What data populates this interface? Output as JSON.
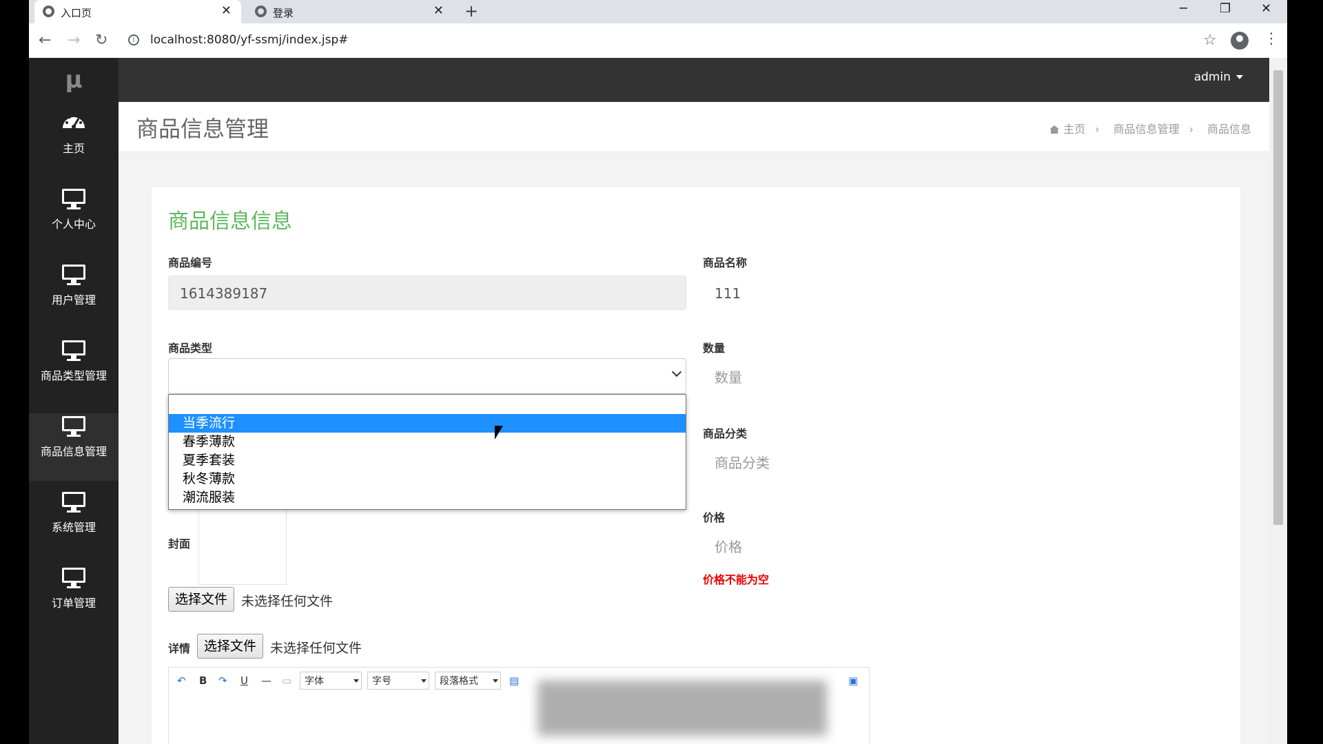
{
  "browser": {
    "tabs": [
      {
        "title": "入口页",
        "close": "✕"
      },
      {
        "title": "登录",
        "close": "✕"
      }
    ],
    "new_tab": "+",
    "window_controls": [
      "─",
      "❐",
      "✕"
    ],
    "url": "localhost:8080/yf-ssmj/index.jsp#"
  },
  "app": {
    "logo": "μ",
    "user_menu": "admin",
    "sidebar": [
      {
        "label": "主页",
        "icon": "dashboard-icon"
      },
      {
        "label": "个人中心",
        "icon": "monitor-icon"
      },
      {
        "label": "用户管理",
        "icon": "monitor-icon"
      },
      {
        "label": "商品类型管理",
        "icon": "monitor-icon"
      },
      {
        "label": "商品信息管理",
        "icon": "monitor-icon"
      },
      {
        "label": "系统管理",
        "icon": "monitor-icon"
      },
      {
        "label": "订单管理",
        "icon": "monitor-icon"
      }
    ],
    "page_title": "商品信息管理",
    "breadcrumb": [
      "主页",
      "商品信息管理",
      "商品信息"
    ]
  },
  "form": {
    "title": "商品信息信息",
    "product_no": {
      "label": "商品编号",
      "value": "1614389187"
    },
    "product_name": {
      "label": "商品名称",
      "value": "111"
    },
    "product_type": {
      "label": "商品类型",
      "value": "",
      "options": [
        "",
        "当季流行",
        "春季薄款",
        "夏季套装",
        "秋冬薄款",
        "潮流服装"
      ],
      "highlighted": "当季流行"
    },
    "quantity": {
      "label": "数量",
      "placeholder": "数量"
    },
    "category": {
      "label": "商品分类",
      "placeholder": "商品分类"
    },
    "price": {
      "label": "价格",
      "placeholder": "价格",
      "error": "价格不能为空"
    },
    "cover": {
      "label": "封面",
      "button": "选择文件",
      "status": "未选择任何文件"
    },
    "detail": {
      "label": "详情",
      "button": "选择文件",
      "status": "未选择任何文件"
    },
    "editor": {
      "font": "字体",
      "size": "字号",
      "paragraph": "段落格式"
    }
  },
  "colors": {
    "accent_green": "#5cb85c",
    "error_red": "#e00000",
    "highlight_blue": "#1e90ff",
    "sidebar_bg": "#222222"
  }
}
